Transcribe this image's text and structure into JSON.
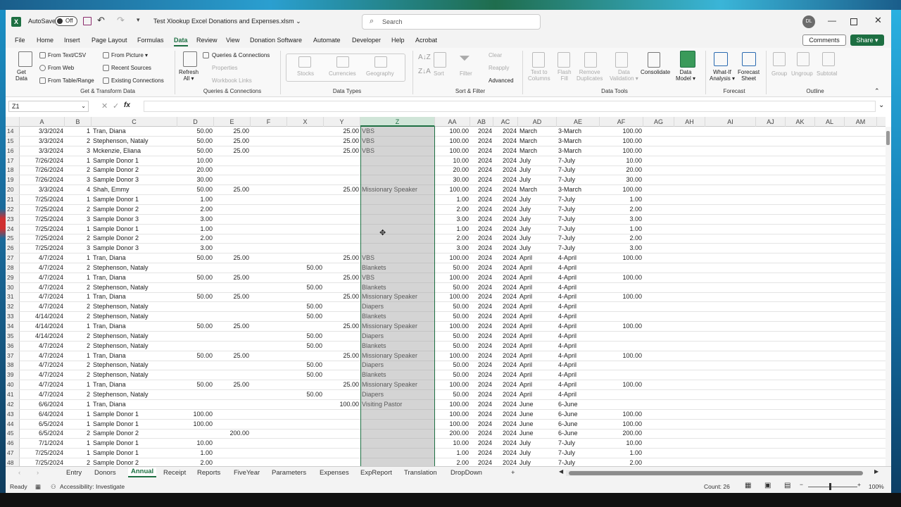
{
  "titlebar": {
    "autosave_label": "AutoSave",
    "autosave_state": "Off",
    "doc_title": "Test Xlookup Excel Donations and Expenses.xlsm ⌄",
    "search_placeholder": "Search",
    "avatar_initials": "DL"
  },
  "menu": {
    "items": [
      "File",
      "Home",
      "Insert",
      "Page Layout",
      "Formulas",
      "Data",
      "Review",
      "View",
      "Donation Software",
      "Automate",
      "Developer",
      "Help",
      "Acrobat"
    ],
    "active": "Data",
    "comments": "Comments",
    "share": "Share ▾"
  },
  "ribbon": {
    "get_data": "Get\nData",
    "from_text_csv": "From Text/CSV",
    "from_web": "From Web",
    "from_table_range": "From Table/Range",
    "from_picture": "From Picture ▾",
    "recent_sources": "Recent Sources",
    "existing_connections": "Existing Connections",
    "group_get_transform": "Get & Transform Data",
    "refresh_all": "Refresh\nAll ▾",
    "queries_connections": "Queries & Connections",
    "properties": "Properties",
    "workbook_links": "Workbook Links",
    "group_queries": "Queries & Connections",
    "stocks": "Stocks",
    "currencies": "Currencies",
    "geography": "Geography",
    "group_data_types": "Data Types",
    "sort": "Sort",
    "filter": "Filter",
    "clear": "Clear",
    "reapply": "Reapply",
    "advanced": "Advanced",
    "group_sort_filter": "Sort & Filter",
    "text_to_columns": "Text to\nColumns",
    "flash_fill": "Flash\nFill",
    "remove_duplicates": "Remove\nDuplicates",
    "data_validation": "Data\nValidation ▾",
    "consolidate": "Consolidate",
    "data_model": "Data\nModel ▾",
    "group_data_tools": "Data Tools",
    "what_if": "What-If\nAnalysis ▾",
    "forecast_sheet": "Forecast\nSheet",
    "group_forecast": "Forecast",
    "group_btn": "Group",
    "ungroup": "Ungroup",
    "subtotal": "Subtotal",
    "group_outline": "Outline"
  },
  "formula": {
    "name_box": "Z1",
    "fx": "fx",
    "content": ""
  },
  "grid": {
    "columns": [
      "A",
      "B",
      "C",
      "D",
      "E",
      "F",
      "X",
      "Y",
      "Z",
      "AA",
      "AB",
      "AC",
      "AD",
      "AE",
      "AF",
      "AG",
      "AH",
      "AI",
      "AJ",
      "AK",
      "AL",
      "AM"
    ],
    "selected_column": "Z",
    "rows": [
      {
        "n": "14",
        "A": "3/3/2024",
        "B": "1",
        "C": "Tran, Diana",
        "D": "50.00",
        "E": "25.00",
        "X": "",
        "Y": "25.00",
        "Z": "VBS",
        "AA": "100.00",
        "AB": "2024",
        "AC": "2024",
        "AD": "March",
        "AE": "3-March",
        "AF": "100.00"
      },
      {
        "n": "15",
        "A": "3/3/2024",
        "B": "2",
        "C": "Stephenson, Nataly",
        "D": "50.00",
        "E": "25.00",
        "X": "",
        "Y": "25.00",
        "Z": "VBS",
        "AA": "100.00",
        "AB": "2024",
        "AC": "2024",
        "AD": "March",
        "AE": "3-March",
        "AF": "100.00"
      },
      {
        "n": "16",
        "A": "3/3/2024",
        "B": "3",
        "C": "Mckenzie, Eliana",
        "D": "50.00",
        "E": "25.00",
        "X": "",
        "Y": "25.00",
        "Z": "VBS",
        "AA": "100.00",
        "AB": "2024",
        "AC": "2024",
        "AD": "March",
        "AE": "3-March",
        "AF": "100.00"
      },
      {
        "n": "17",
        "A": "7/26/2024",
        "B": "1",
        "C": "Sample Donor 1",
        "D": "10.00",
        "E": "",
        "X": "",
        "Y": "",
        "Z": "",
        "AA": "10.00",
        "AB": "2024",
        "AC": "2024",
        "AD": "July",
        "AE": "7-July",
        "AF": "10.00"
      },
      {
        "n": "18",
        "A": "7/26/2024",
        "B": "2",
        "C": "Sample Donor 2",
        "D": "20.00",
        "E": "",
        "X": "",
        "Y": "",
        "Z": "",
        "AA": "20.00",
        "AB": "2024",
        "AC": "2024",
        "AD": "July",
        "AE": "7-July",
        "AF": "20.00"
      },
      {
        "n": "19",
        "A": "7/26/2024",
        "B": "3",
        "C": "Sample Donor 3",
        "D": "30.00",
        "E": "",
        "X": "",
        "Y": "",
        "Z": "",
        "AA": "30.00",
        "AB": "2024",
        "AC": "2024",
        "AD": "July",
        "AE": "7-July",
        "AF": "30.00"
      },
      {
        "n": "20",
        "A": "3/3/2024",
        "B": "4",
        "C": "Shah, Emmy",
        "D": "50.00",
        "E": "25.00",
        "X": "",
        "Y": "25.00",
        "Z": "Missionary Speaker",
        "AA": "100.00",
        "AB": "2024",
        "AC": "2024",
        "AD": "March",
        "AE": "3-March",
        "AF": "100.00"
      },
      {
        "n": "21",
        "A": "7/25/2024",
        "B": "1",
        "C": "Sample Donor 1",
        "D": "1.00",
        "E": "",
        "X": "",
        "Y": "",
        "Z": "",
        "AA": "1.00",
        "AB": "2024",
        "AC": "2024",
        "AD": "July",
        "AE": "7-July",
        "AF": "1.00"
      },
      {
        "n": "22",
        "A": "7/25/2024",
        "B": "2",
        "C": "Sample Donor 2",
        "D": "2.00",
        "E": "",
        "X": "",
        "Y": "",
        "Z": "",
        "AA": "2.00",
        "AB": "2024",
        "AC": "2024",
        "AD": "July",
        "AE": "7-July",
        "AF": "2.00"
      },
      {
        "n": "23",
        "A": "7/25/2024",
        "B": "3",
        "C": "Sample Donor 3",
        "D": "3.00",
        "E": "",
        "X": "",
        "Y": "",
        "Z": "",
        "AA": "3.00",
        "AB": "2024",
        "AC": "2024",
        "AD": "July",
        "AE": "7-July",
        "AF": "3.00"
      },
      {
        "n": "24",
        "A": "7/25/2024",
        "B": "1",
        "C": "Sample Donor 1",
        "D": "1.00",
        "E": "",
        "X": "",
        "Y": "",
        "Z": "",
        "AA": "1.00",
        "AB": "2024",
        "AC": "2024",
        "AD": "July",
        "AE": "7-July",
        "AF": "1.00"
      },
      {
        "n": "25",
        "A": "7/25/2024",
        "B": "2",
        "C": "Sample Donor 2",
        "D": "2.00",
        "E": "",
        "X": "",
        "Y": "",
        "Z": "",
        "AA": "2.00",
        "AB": "2024",
        "AC": "2024",
        "AD": "July",
        "AE": "7-July",
        "AF": "2.00"
      },
      {
        "n": "26",
        "A": "7/25/2024",
        "B": "3",
        "C": "Sample Donor 3",
        "D": "3.00",
        "E": "",
        "X": "",
        "Y": "",
        "Z": "",
        "AA": "3.00",
        "AB": "2024",
        "AC": "2024",
        "AD": "July",
        "AE": "7-July",
        "AF": "3.00"
      },
      {
        "n": "27",
        "A": "4/7/2024",
        "B": "1",
        "C": "Tran, Diana",
        "D": "50.00",
        "E": "25.00",
        "X": "",
        "Y": "25.00",
        "Z": "VBS",
        "AA": "100.00",
        "AB": "2024",
        "AC": "2024",
        "AD": "April",
        "AE": "4-April",
        "AF": "100.00"
      },
      {
        "n": "28",
        "A": "4/7/2024",
        "B": "2",
        "C": "Stephenson, Nataly",
        "D": "",
        "E": "",
        "X": "50.00",
        "Y": "",
        "Z": "Blankets",
        "AA": "50.00",
        "AB": "2024",
        "AC": "2024",
        "AD": "April",
        "AE": "4-April",
        "AF": ""
      },
      {
        "n": "29",
        "A": "4/7/2024",
        "B": "1",
        "C": "Tran, Diana",
        "D": "50.00",
        "E": "25.00",
        "X": "",
        "Y": "25.00",
        "Z": "VBS",
        "AA": "100.00",
        "AB": "2024",
        "AC": "2024",
        "AD": "April",
        "AE": "4-April",
        "AF": "100.00"
      },
      {
        "n": "30",
        "A": "4/7/2024",
        "B": "2",
        "C": "Stephenson, Nataly",
        "D": "",
        "E": "",
        "X": "50.00",
        "Y": "",
        "Z": "Blankets",
        "AA": "50.00",
        "AB": "2024",
        "AC": "2024",
        "AD": "April",
        "AE": "4-April",
        "AF": ""
      },
      {
        "n": "31",
        "A": "4/7/2024",
        "B": "1",
        "C": "Tran, Diana",
        "D": "50.00",
        "E": "25.00",
        "X": "",
        "Y": "25.00",
        "Z": "Missionary Speaker",
        "AA": "100.00",
        "AB": "2024",
        "AC": "2024",
        "AD": "April",
        "AE": "4-April",
        "AF": "100.00"
      },
      {
        "n": "32",
        "A": "4/7/2024",
        "B": "2",
        "C": "Stephenson, Nataly",
        "D": "",
        "E": "",
        "X": "50.00",
        "Y": "",
        "Z": "Diapers",
        "AA": "50.00",
        "AB": "2024",
        "AC": "2024",
        "AD": "April",
        "AE": "4-April",
        "AF": ""
      },
      {
        "n": "33",
        "A": "4/14/2024",
        "B": "2",
        "C": "Stephenson, Nataly",
        "D": "",
        "E": "",
        "X": "50.00",
        "Y": "",
        "Z": "Blankets",
        "AA": "50.00",
        "AB": "2024",
        "AC": "2024",
        "AD": "April",
        "AE": "4-April",
        "AF": ""
      },
      {
        "n": "34",
        "A": "4/14/2024",
        "B": "1",
        "C": "Tran, Diana",
        "D": "50.00",
        "E": "25.00",
        "X": "",
        "Y": "25.00",
        "Z": "Missionary Speaker",
        "AA": "100.00",
        "AB": "2024",
        "AC": "2024",
        "AD": "April",
        "AE": "4-April",
        "AF": "100.00"
      },
      {
        "n": "35",
        "A": "4/14/2024",
        "B": "2",
        "C": "Stephenson, Nataly",
        "D": "",
        "E": "",
        "X": "50.00",
        "Y": "",
        "Z": "Diapers",
        "AA": "50.00",
        "AB": "2024",
        "AC": "2024",
        "AD": "April",
        "AE": "4-April",
        "AF": ""
      },
      {
        "n": "36",
        "A": "4/7/2024",
        "B": "2",
        "C": "Stephenson, Nataly",
        "D": "",
        "E": "",
        "X": "50.00",
        "Y": "",
        "Z": "Blankets",
        "AA": "50.00",
        "AB": "2024",
        "AC": "2024",
        "AD": "April",
        "AE": "4-April",
        "AF": ""
      },
      {
        "n": "37",
        "A": "4/7/2024",
        "B": "1",
        "C": "Tran, Diana",
        "D": "50.00",
        "E": "25.00",
        "X": "",
        "Y": "25.00",
        "Z": "Missionary Speaker",
        "AA": "100.00",
        "AB": "2024",
        "AC": "2024",
        "AD": "April",
        "AE": "4-April",
        "AF": "100.00"
      },
      {
        "n": "38",
        "A": "4/7/2024",
        "B": "2",
        "C": "Stephenson, Nataly",
        "D": "",
        "E": "",
        "X": "50.00",
        "Y": "",
        "Z": "Diapers",
        "AA": "50.00",
        "AB": "2024",
        "AC": "2024",
        "AD": "April",
        "AE": "4-April",
        "AF": ""
      },
      {
        "n": "39",
        "A": "4/7/2024",
        "B": "2",
        "C": "Stephenson, Nataly",
        "D": "",
        "E": "",
        "X": "50.00",
        "Y": "",
        "Z": "Blankets",
        "AA": "50.00",
        "AB": "2024",
        "AC": "2024",
        "AD": "April",
        "AE": "4-April",
        "AF": ""
      },
      {
        "n": "40",
        "A": "4/7/2024",
        "B": "1",
        "C": "Tran, Diana",
        "D": "50.00",
        "E": "25.00",
        "X": "",
        "Y": "25.00",
        "Z": "Missionary Speaker",
        "AA": "100.00",
        "AB": "2024",
        "AC": "2024",
        "AD": "April",
        "AE": "4-April",
        "AF": "100.00"
      },
      {
        "n": "41",
        "A": "4/7/2024",
        "B": "2",
        "C": "Stephenson, Nataly",
        "D": "",
        "E": "",
        "X": "50.00",
        "Y": "",
        "Z": "Diapers",
        "AA": "50.00",
        "AB": "2024",
        "AC": "2024",
        "AD": "April",
        "AE": "4-April",
        "AF": ""
      },
      {
        "n": "42",
        "A": "6/6/2024",
        "B": "1",
        "C": "Tran, Diana",
        "D": "",
        "E": "",
        "X": "",
        "Y": "100.00",
        "Z": "Visiting Pastor",
        "AA": "100.00",
        "AB": "2024",
        "AC": "2024",
        "AD": "June",
        "AE": "6-June",
        "AF": ""
      },
      {
        "n": "43",
        "A": "6/4/2024",
        "B": "1",
        "C": "Sample Donor 1",
        "D": "100.00",
        "E": "",
        "X": "",
        "Y": "",
        "Z": "",
        "AA": "100.00",
        "AB": "2024",
        "AC": "2024",
        "AD": "June",
        "AE": "6-June",
        "AF": "100.00"
      },
      {
        "n": "44",
        "A": "6/5/2024",
        "B": "1",
        "C": "Sample Donor 1",
        "D": "100.00",
        "E": "",
        "X": "",
        "Y": "",
        "Z": "",
        "AA": "100.00",
        "AB": "2024",
        "AC": "2024",
        "AD": "June",
        "AE": "6-June",
        "AF": "100.00"
      },
      {
        "n": "45",
        "A": "6/5/2024",
        "B": "2",
        "C": "Sample Donor 2",
        "D": "",
        "E": "200.00",
        "X": "",
        "Y": "",
        "Z": "",
        "AA": "200.00",
        "AB": "2024",
        "AC": "2024",
        "AD": "June",
        "AE": "6-June",
        "AF": "200.00"
      },
      {
        "n": "46",
        "A": "7/1/2024",
        "B": "1",
        "C": "Sample Donor 1",
        "D": "10.00",
        "E": "",
        "X": "",
        "Y": "",
        "Z": "",
        "AA": "10.00",
        "AB": "2024",
        "AC": "2024",
        "AD": "July",
        "AE": "7-July",
        "AF": "10.00"
      },
      {
        "n": "47",
        "A": "7/25/2024",
        "B": "1",
        "C": "Sample Donor 1",
        "D": "1.00",
        "E": "",
        "X": "",
        "Y": "",
        "Z": "",
        "AA": "1.00",
        "AB": "2024",
        "AC": "2024",
        "AD": "July",
        "AE": "7-July",
        "AF": "1.00"
      },
      {
        "n": "48",
        "A": "7/25/2024",
        "B": "2",
        "C": "Sample Donor 2",
        "D": "2.00",
        "E": "",
        "X": "",
        "Y": "",
        "Z": "",
        "AA": "2.00",
        "AB": "2024",
        "AC": "2024",
        "AD": "July",
        "AE": "7-July",
        "AF": "2.00"
      }
    ]
  },
  "tabs": {
    "items": [
      "Entry",
      "Donors",
      "Annual",
      "Receipt",
      "Reports",
      "FiveYear",
      "Parameters",
      "Expenses",
      "ExpReport",
      "Translation",
      "DropDown"
    ],
    "active": "Annual",
    "add": "+"
  },
  "status": {
    "ready": "Ready",
    "accessibility": "Accessibility: Investigate",
    "count": "Count: 26",
    "zoom": "100%"
  },
  "colors": {
    "accent": "#1d6f42",
    "selection_fill": "#a0a0a0"
  }
}
